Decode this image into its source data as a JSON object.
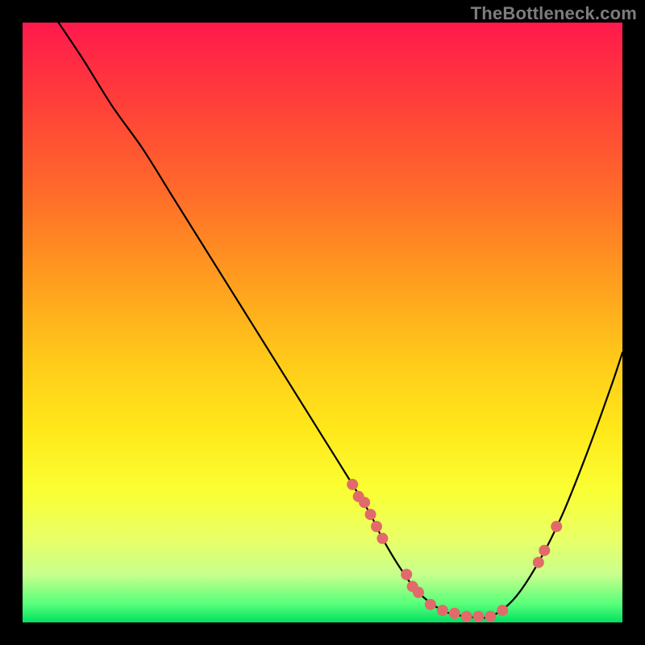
{
  "watermark": "TheBottleneck.com",
  "colors": {
    "marker": "#e26a6a",
    "curve": "#000000",
    "frame_bg_top": "#ff1a4d",
    "frame_bg_bottom": "#00e060"
  },
  "chart_data": {
    "type": "line",
    "title": "",
    "xlabel": "",
    "ylabel": "",
    "xlim": [
      0,
      100
    ],
    "ylim": [
      0,
      100
    ],
    "note": "Values are read in percent of plot area; y=0 is bottom edge, y=100 is top edge. Curve depicts a bottleneck V-shape.",
    "series": [
      {
        "name": "bottleneck-curve",
        "x": [
          6,
          10,
          15,
          20,
          25,
          30,
          35,
          40,
          45,
          50,
          55,
          58,
          60,
          63,
          66,
          70,
          74,
          78,
          82,
          86,
          90,
          94,
          98,
          100
        ],
        "y": [
          100,
          94,
          86,
          79,
          71,
          63,
          55,
          47,
          39,
          31,
          23,
          18,
          14,
          9,
          5,
          2,
          1,
          1,
          4,
          10,
          18,
          28,
          39,
          45
        ]
      }
    ],
    "markers": {
      "name": "highlighted-points",
      "x": [
        55,
        56,
        57,
        58,
        59,
        60,
        64,
        65,
        66,
        68,
        70,
        72,
        74,
        76,
        78,
        80,
        86,
        87,
        89
      ],
      "y": [
        23,
        21,
        20,
        18,
        16,
        14,
        8,
        6,
        5,
        3,
        2,
        1.5,
        1,
        1,
        1,
        2,
        10,
        12,
        16
      ]
    }
  }
}
